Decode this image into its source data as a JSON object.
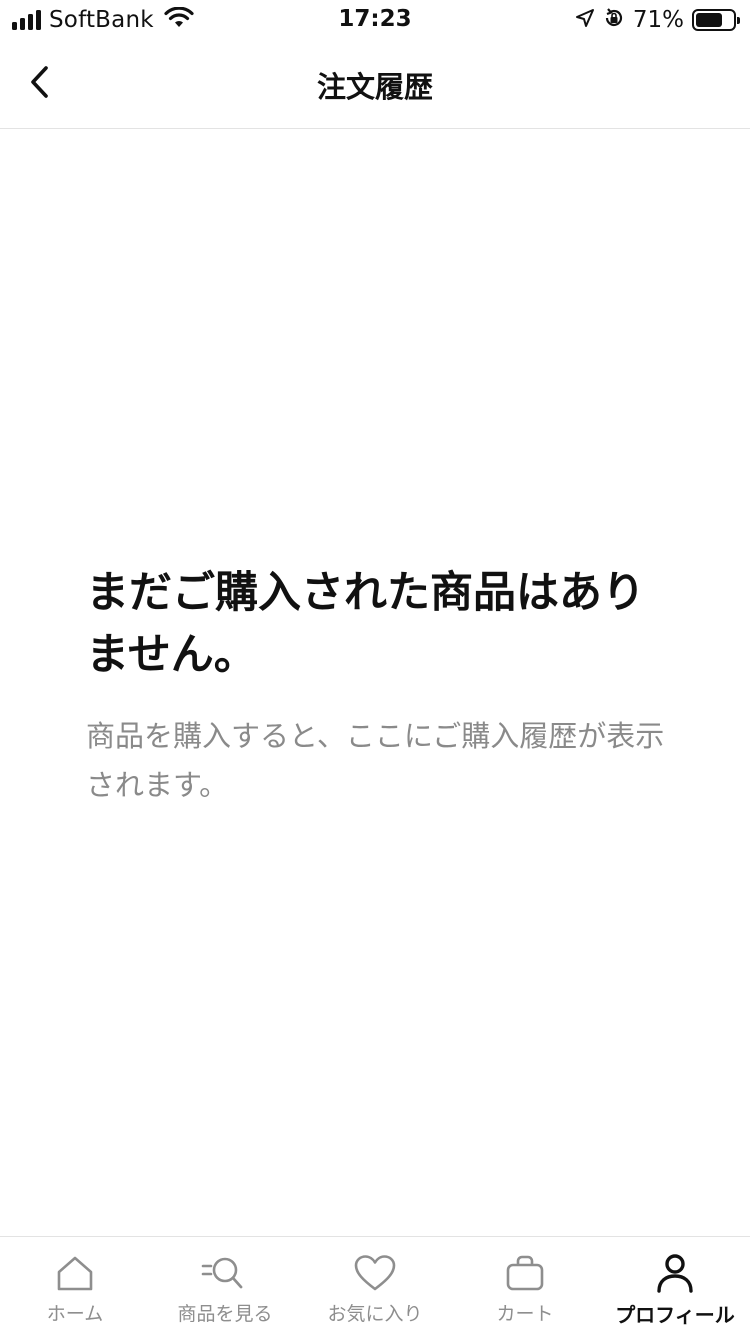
{
  "status_bar": {
    "carrier": "SoftBank",
    "time": "17:23",
    "battery_percent": "71%",
    "battery_level": 0.71
  },
  "nav": {
    "title": "注文履歴",
    "back_icon": "chevron-left-icon"
  },
  "empty_state": {
    "title": "まだご購入された商品はありません。",
    "message": "商品を購入すると、ここにご購入履歴が表示されます。"
  },
  "tab_bar": {
    "items": [
      {
        "label": "ホーム",
        "icon": "home-icon",
        "active": false
      },
      {
        "label": "商品を見る",
        "icon": "search-icon",
        "active": false
      },
      {
        "label": "お気に入り",
        "icon": "heart-icon",
        "active": false
      },
      {
        "label": "カート",
        "icon": "bag-icon",
        "active": false
      },
      {
        "label": "プロフィール",
        "icon": "person-icon",
        "active": true
      }
    ]
  },
  "colors": {
    "text_primary": "#111111",
    "text_secondary": "#8a8a8a",
    "tab_inactive": "#8e8e8e",
    "divider": "#e3e3e3"
  }
}
